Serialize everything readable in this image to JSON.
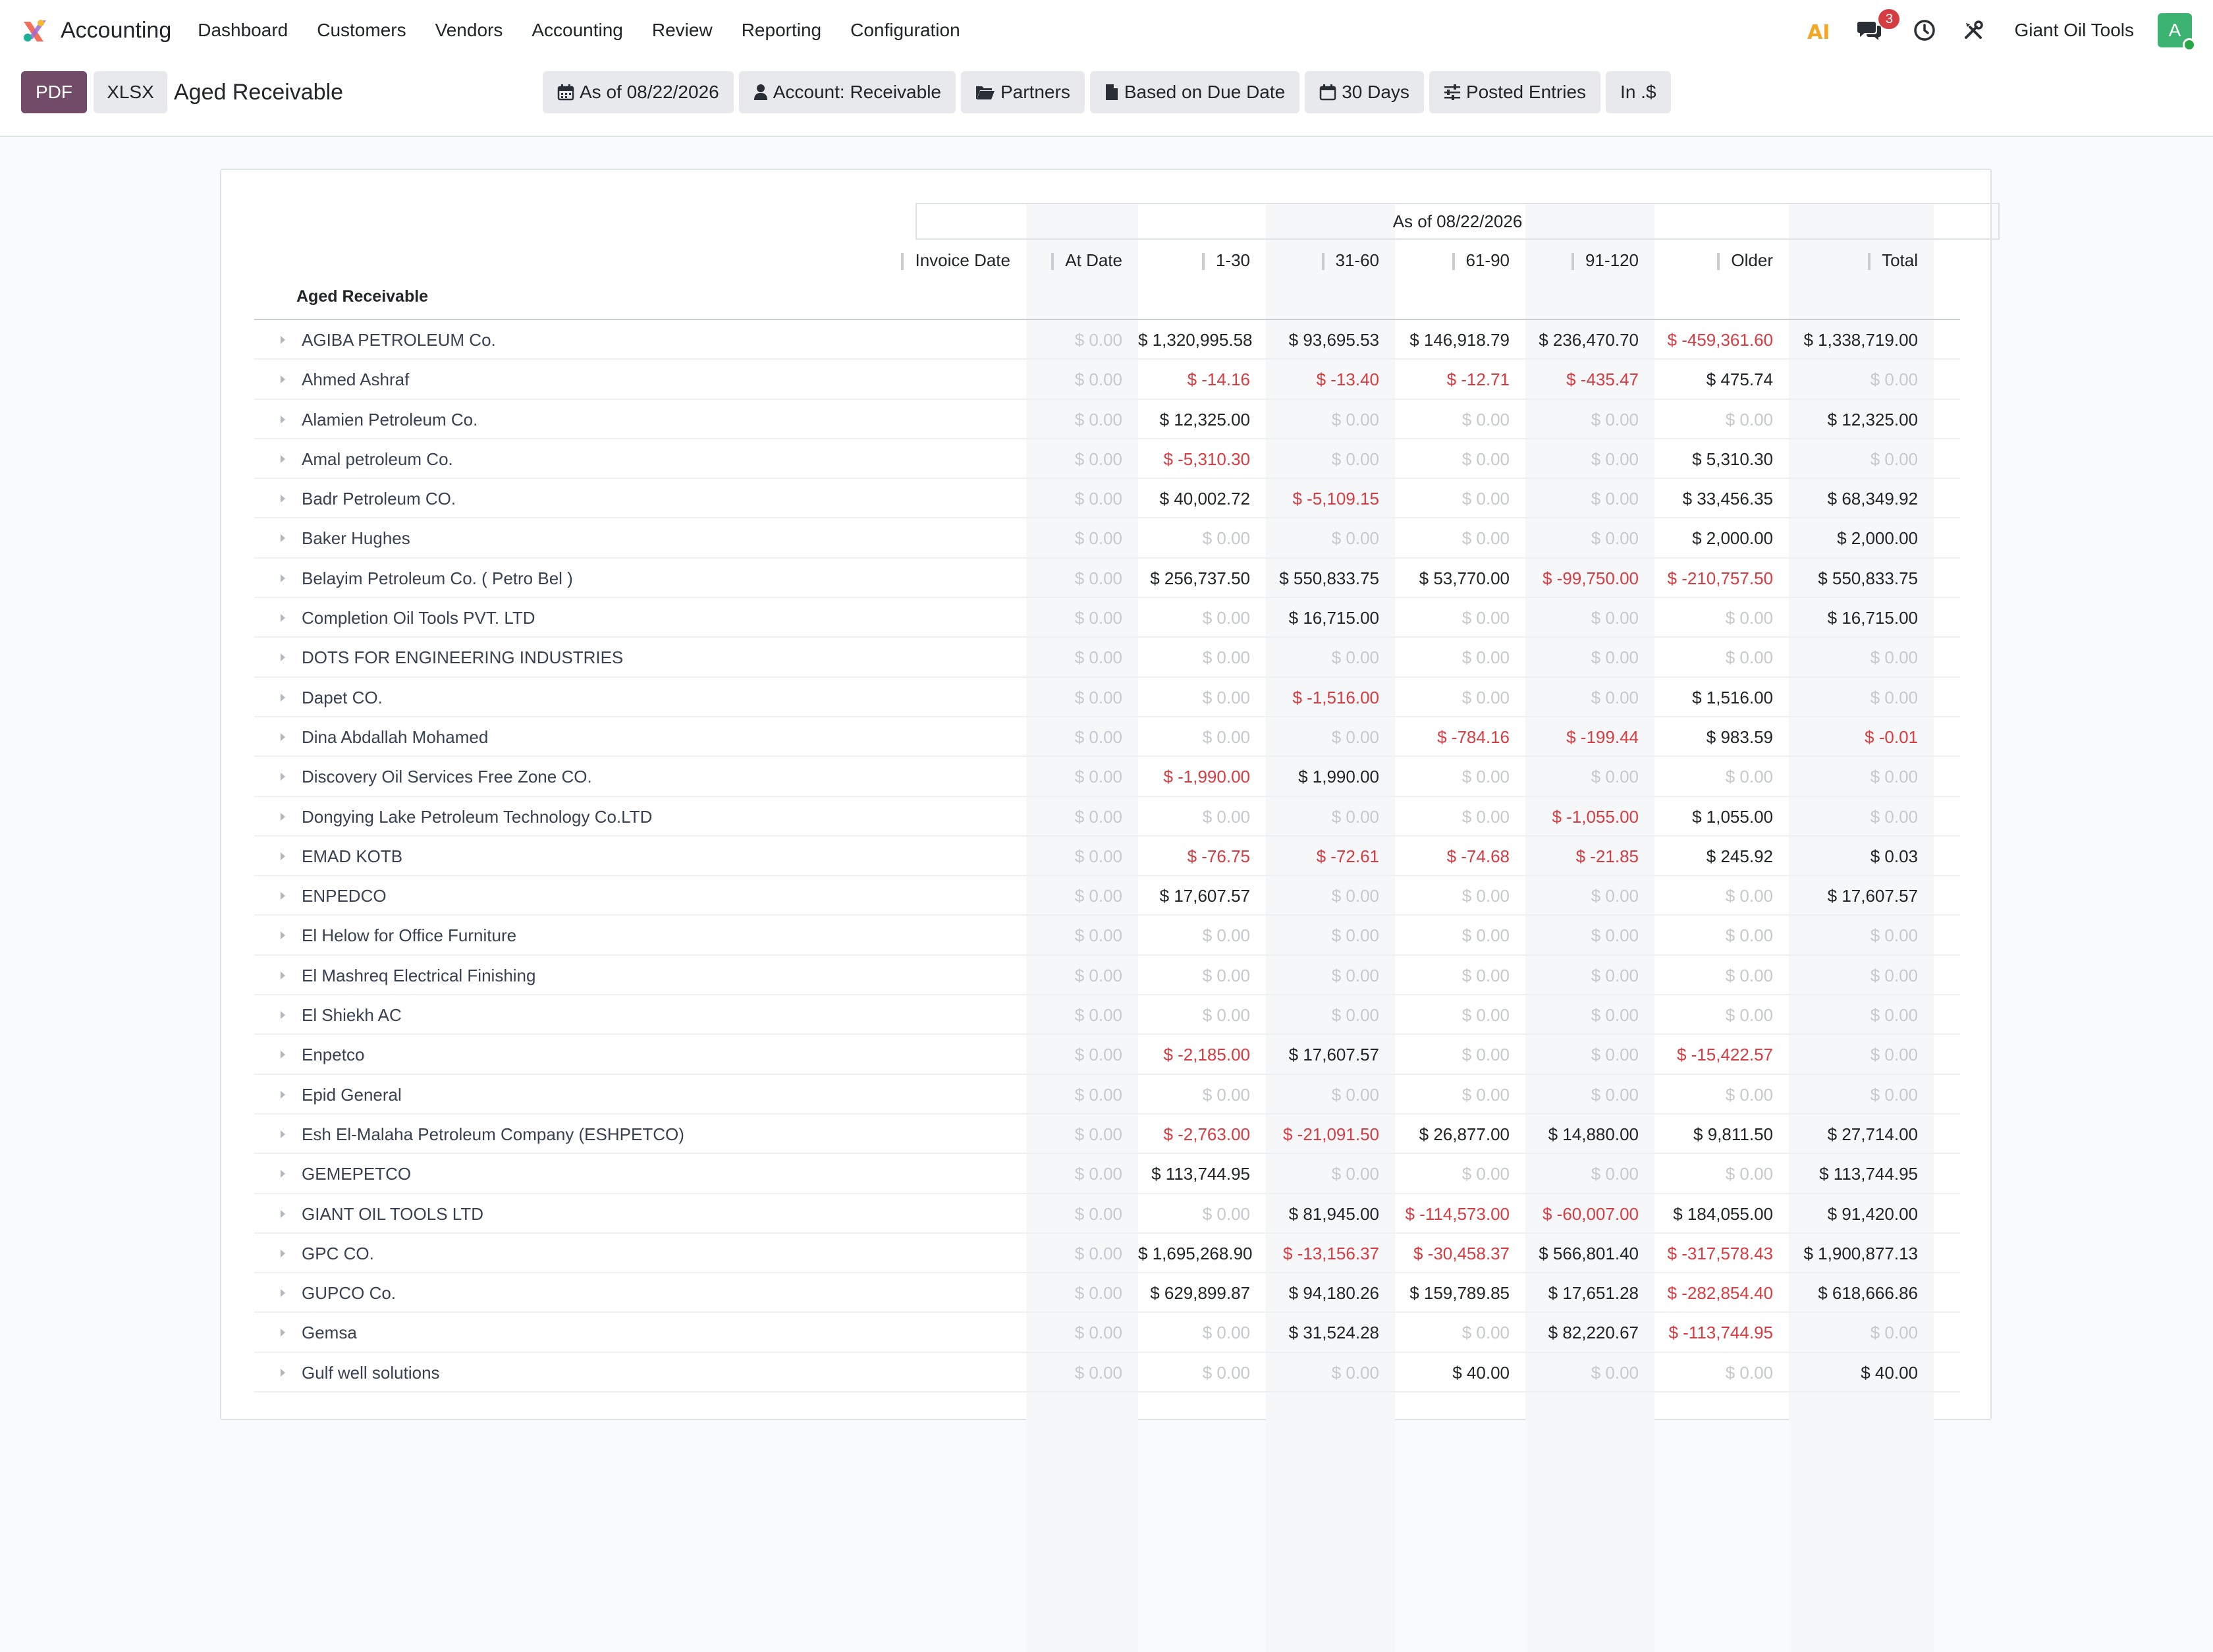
{
  "navbar": {
    "app_name": "Accounting",
    "menu": [
      "Dashboard",
      "Customers",
      "Vendors",
      "Accounting",
      "Review",
      "Reporting",
      "Configuration"
    ],
    "ai_label": "AI",
    "messages_count": "3",
    "company": "Giant Oil Tools",
    "avatar_letter": "A"
  },
  "control_panel": {
    "pdf_label": "PDF",
    "xlsx_label": "XLSX",
    "title": "Aged Receivable",
    "filters": {
      "date": "As of 08/22/2026",
      "account": "Account: Receivable",
      "partners": "Partners",
      "based_on": "Based on Due Date",
      "period": "30 Days",
      "entries": "Posted Entries",
      "currency": "In .$"
    }
  },
  "report": {
    "period_header": "As of 08/22/2026",
    "columns": [
      "Invoice Date",
      "At Date",
      "1-30",
      "31-60",
      "61-90",
      "91-120",
      "Older",
      "Total"
    ],
    "section_label": "Aged Receivable",
    "rows": [
      {
        "name": "AGIBA PETROLEUM Co.",
        "values": [
          "$ 0.00",
          "$ 1,320,995.58",
          "$ 93,695.53",
          "$ 146,918.79",
          "$ 236,470.70",
          "$ -459,361.60",
          "$ 1,338,719.00"
        ]
      },
      {
        "name": "Ahmed Ashraf",
        "values": [
          "$ 0.00",
          "$ -14.16",
          "$ -13.40",
          "$ -12.71",
          "$ -435.47",
          "$ 475.74",
          "$ 0.00"
        ]
      },
      {
        "name": "Alamien Petroleum Co.",
        "values": [
          "$ 0.00",
          "$ 12,325.00",
          "$ 0.00",
          "$ 0.00",
          "$ 0.00",
          "$ 0.00",
          "$ 12,325.00"
        ]
      },
      {
        "name": "Amal petroleum Co.",
        "values": [
          "$ 0.00",
          "$ -5,310.30",
          "$ 0.00",
          "$ 0.00",
          "$ 0.00",
          "$ 5,310.30",
          "$ 0.00"
        ]
      },
      {
        "name": "Badr Petroleum CO.",
        "values": [
          "$ 0.00",
          "$ 40,002.72",
          "$ -5,109.15",
          "$ 0.00",
          "$ 0.00",
          "$ 33,456.35",
          "$ 68,349.92"
        ]
      },
      {
        "name": "Baker Hughes",
        "values": [
          "$ 0.00",
          "$ 0.00",
          "$ 0.00",
          "$ 0.00",
          "$ 0.00",
          "$ 2,000.00",
          "$ 2,000.00"
        ]
      },
      {
        "name": "Belayim Petroleum Co. ( Petro Bel )",
        "values": [
          "$ 0.00",
          "$ 256,737.50",
          "$ 550,833.75",
          "$ 53,770.00",
          "$ -99,750.00",
          "$ -210,757.50",
          "$ 550,833.75"
        ]
      },
      {
        "name": "Completion Oil Tools PVT. LTD",
        "values": [
          "$ 0.00",
          "$ 0.00",
          "$ 16,715.00",
          "$ 0.00",
          "$ 0.00",
          "$ 0.00",
          "$ 16,715.00"
        ]
      },
      {
        "name": "DOTS FOR ENGINEERING INDUSTRIES",
        "values": [
          "$ 0.00",
          "$ 0.00",
          "$ 0.00",
          "$ 0.00",
          "$ 0.00",
          "$ 0.00",
          "$ 0.00"
        ]
      },
      {
        "name": "Dapet CO.",
        "values": [
          "$ 0.00",
          "$ 0.00",
          "$ -1,516.00",
          "$ 0.00",
          "$ 0.00",
          "$ 1,516.00",
          "$ 0.00"
        ]
      },
      {
        "name": "Dina Abdallah Mohamed",
        "values": [
          "$ 0.00",
          "$ 0.00",
          "$ 0.00",
          "$ -784.16",
          "$ -199.44",
          "$ 983.59",
          "$ -0.01"
        ]
      },
      {
        "name": "Discovery Oil Services Free Zone CO.",
        "values": [
          "$ 0.00",
          "$ -1,990.00",
          "$ 1,990.00",
          "$ 0.00",
          "$ 0.00",
          "$ 0.00",
          "$ 0.00"
        ]
      },
      {
        "name": "Dongying Lake Petroleum Technology Co.LTD",
        "values": [
          "$ 0.00",
          "$ 0.00",
          "$ 0.00",
          "$ 0.00",
          "$ -1,055.00",
          "$ 1,055.00",
          "$ 0.00"
        ]
      },
      {
        "name": "EMAD KOTB",
        "values": [
          "$ 0.00",
          "$ -76.75",
          "$ -72.61",
          "$ -74.68",
          "$ -21.85",
          "$ 245.92",
          "$ 0.03"
        ]
      },
      {
        "name": "ENPEDCO",
        "values": [
          "$ 0.00",
          "$ 17,607.57",
          "$ 0.00",
          "$ 0.00",
          "$ 0.00",
          "$ 0.00",
          "$ 17,607.57"
        ]
      },
      {
        "name": "El Helow for Office Furniture",
        "values": [
          "$ 0.00",
          "$ 0.00",
          "$ 0.00",
          "$ 0.00",
          "$ 0.00",
          "$ 0.00",
          "$ 0.00"
        ]
      },
      {
        "name": "El Mashreq Electrical Finishing",
        "values": [
          "$ 0.00",
          "$ 0.00",
          "$ 0.00",
          "$ 0.00",
          "$ 0.00",
          "$ 0.00",
          "$ 0.00"
        ]
      },
      {
        "name": "El Shiekh AC",
        "values": [
          "$ 0.00",
          "$ 0.00",
          "$ 0.00",
          "$ 0.00",
          "$ 0.00",
          "$ 0.00",
          "$ 0.00"
        ]
      },
      {
        "name": "Enpetco",
        "values": [
          "$ 0.00",
          "$ -2,185.00",
          "$ 17,607.57",
          "$ 0.00",
          "$ 0.00",
          "$ -15,422.57",
          "$ 0.00"
        ]
      },
      {
        "name": "Epid General",
        "values": [
          "$ 0.00",
          "$ 0.00",
          "$ 0.00",
          "$ 0.00",
          "$ 0.00",
          "$ 0.00",
          "$ 0.00"
        ]
      },
      {
        "name": "Esh El-Malaha Petroleum Company (ESHPETCO)",
        "values": [
          "$ 0.00",
          "$ -2,763.00",
          "$ -21,091.50",
          "$ 26,877.00",
          "$ 14,880.00",
          "$ 9,811.50",
          "$ 27,714.00"
        ]
      },
      {
        "name": "GEMEPETCO",
        "values": [
          "$ 0.00",
          "$ 113,744.95",
          "$ 0.00",
          "$ 0.00",
          "$ 0.00",
          "$ 0.00",
          "$ 113,744.95"
        ]
      },
      {
        "name": "GIANT OIL TOOLS LTD",
        "values": [
          "$ 0.00",
          "$ 0.00",
          "$ 81,945.00",
          "$ -114,573.00",
          "$ -60,007.00",
          "$ 184,055.00",
          "$ 91,420.00"
        ]
      },
      {
        "name": "GPC CO.",
        "values": [
          "$ 0.00",
          "$ 1,695,268.90",
          "$ -13,156.37",
          "$ -30,458.37",
          "$ 566,801.40",
          "$ -317,578.43",
          "$ 1,900,877.13"
        ]
      },
      {
        "name": "GUPCO Co.",
        "values": [
          "$ 0.00",
          "$ 629,899.87",
          "$ 94,180.26",
          "$ 159,789.85",
          "$ 17,651.28",
          "$ -282,854.40",
          "$ 618,666.86"
        ]
      },
      {
        "name": "Gemsa",
        "values": [
          "$ 0.00",
          "$ 0.00",
          "$ 31,524.28",
          "$ 0.00",
          "$ 82,220.67",
          "$ -113,744.95",
          "$ 0.00"
        ]
      },
      {
        "name": "Gulf well solutions",
        "values": [
          "$ 0.00",
          "$ 0.00",
          "$ 0.00",
          "$ 40.00",
          "$ 0.00",
          "$ 0.00",
          "$ 40.00"
        ]
      }
    ]
  },
  "colors": {
    "brand_purple": "#714b67",
    "negative_red": "#d63d42",
    "zero_gray": "#c6c9cd",
    "avatar_green": "#3cb371"
  }
}
